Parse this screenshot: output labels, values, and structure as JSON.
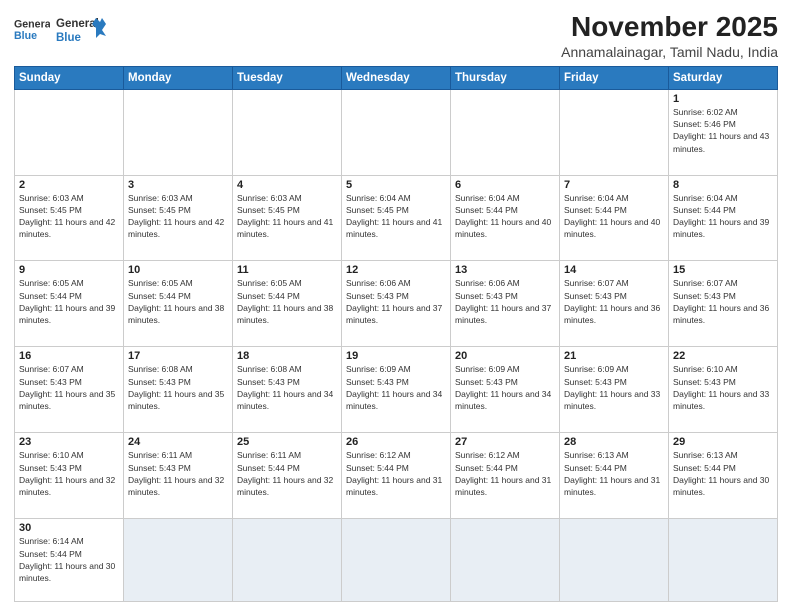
{
  "header": {
    "logo_line1": "General",
    "logo_line2": "Blue",
    "title": "November 2025",
    "subtitle": "Annamalainagar, Tamil Nadu, India"
  },
  "weekdays": [
    "Sunday",
    "Monday",
    "Tuesday",
    "Wednesday",
    "Thursday",
    "Friday",
    "Saturday"
  ],
  "weeks": [
    [
      {
        "day": null
      },
      {
        "day": null
      },
      {
        "day": null
      },
      {
        "day": null
      },
      {
        "day": null
      },
      {
        "day": null
      },
      {
        "day": 1,
        "sunrise": "6:02 AM",
        "sunset": "5:46 PM",
        "daylight": "11 hours and 43 minutes."
      }
    ],
    [
      {
        "day": 2,
        "sunrise": "6:03 AM",
        "sunset": "5:45 PM",
        "daylight": "11 hours and 42 minutes."
      },
      {
        "day": 3,
        "sunrise": "6:03 AM",
        "sunset": "5:45 PM",
        "daylight": "11 hours and 42 minutes."
      },
      {
        "day": 4,
        "sunrise": "6:03 AM",
        "sunset": "5:45 PM",
        "daylight": "11 hours and 41 minutes."
      },
      {
        "day": 5,
        "sunrise": "6:04 AM",
        "sunset": "5:45 PM",
        "daylight": "11 hours and 41 minutes."
      },
      {
        "day": 6,
        "sunrise": "6:04 AM",
        "sunset": "5:44 PM",
        "daylight": "11 hours and 40 minutes."
      },
      {
        "day": 7,
        "sunrise": "6:04 AM",
        "sunset": "5:44 PM",
        "daylight": "11 hours and 40 minutes."
      },
      {
        "day": 8,
        "sunrise": "6:04 AM",
        "sunset": "5:44 PM",
        "daylight": "11 hours and 39 minutes."
      }
    ],
    [
      {
        "day": 9,
        "sunrise": "6:05 AM",
        "sunset": "5:44 PM",
        "daylight": "11 hours and 39 minutes."
      },
      {
        "day": 10,
        "sunrise": "6:05 AM",
        "sunset": "5:44 PM",
        "daylight": "11 hours and 38 minutes."
      },
      {
        "day": 11,
        "sunrise": "6:05 AM",
        "sunset": "5:44 PM",
        "daylight": "11 hours and 38 minutes."
      },
      {
        "day": 12,
        "sunrise": "6:06 AM",
        "sunset": "5:43 PM",
        "daylight": "11 hours and 37 minutes."
      },
      {
        "day": 13,
        "sunrise": "6:06 AM",
        "sunset": "5:43 PM",
        "daylight": "11 hours and 37 minutes."
      },
      {
        "day": 14,
        "sunrise": "6:07 AM",
        "sunset": "5:43 PM",
        "daylight": "11 hours and 36 minutes."
      },
      {
        "day": 15,
        "sunrise": "6:07 AM",
        "sunset": "5:43 PM",
        "daylight": "11 hours and 36 minutes."
      }
    ],
    [
      {
        "day": 16,
        "sunrise": "6:07 AM",
        "sunset": "5:43 PM",
        "daylight": "11 hours and 35 minutes."
      },
      {
        "day": 17,
        "sunrise": "6:08 AM",
        "sunset": "5:43 PM",
        "daylight": "11 hours and 35 minutes."
      },
      {
        "day": 18,
        "sunrise": "6:08 AM",
        "sunset": "5:43 PM",
        "daylight": "11 hours and 34 minutes."
      },
      {
        "day": 19,
        "sunrise": "6:09 AM",
        "sunset": "5:43 PM",
        "daylight": "11 hours and 34 minutes."
      },
      {
        "day": 20,
        "sunrise": "6:09 AM",
        "sunset": "5:43 PM",
        "daylight": "11 hours and 34 minutes."
      },
      {
        "day": 21,
        "sunrise": "6:09 AM",
        "sunset": "5:43 PM",
        "daylight": "11 hours and 33 minutes."
      },
      {
        "day": 22,
        "sunrise": "6:10 AM",
        "sunset": "5:43 PM",
        "daylight": "11 hours and 33 minutes."
      }
    ],
    [
      {
        "day": 23,
        "sunrise": "6:10 AM",
        "sunset": "5:43 PM",
        "daylight": "11 hours and 32 minutes."
      },
      {
        "day": 24,
        "sunrise": "6:11 AM",
        "sunset": "5:43 PM",
        "daylight": "11 hours and 32 minutes."
      },
      {
        "day": 25,
        "sunrise": "6:11 AM",
        "sunset": "5:44 PM",
        "daylight": "11 hours and 32 minutes."
      },
      {
        "day": 26,
        "sunrise": "6:12 AM",
        "sunset": "5:44 PM",
        "daylight": "11 hours and 31 minutes."
      },
      {
        "day": 27,
        "sunrise": "6:12 AM",
        "sunset": "5:44 PM",
        "daylight": "11 hours and 31 minutes."
      },
      {
        "day": 28,
        "sunrise": "6:13 AM",
        "sunset": "5:44 PM",
        "daylight": "11 hours and 31 minutes."
      },
      {
        "day": 29,
        "sunrise": "6:13 AM",
        "sunset": "5:44 PM",
        "daylight": "11 hours and 30 minutes."
      }
    ],
    [
      {
        "day": 30,
        "sunrise": "6:14 AM",
        "sunset": "5:44 PM",
        "daylight": "11 hours and 30 minutes."
      },
      {
        "day": null
      },
      {
        "day": null
      },
      {
        "day": null
      },
      {
        "day": null
      },
      {
        "day": null
      },
      {
        "day": null
      }
    ]
  ]
}
